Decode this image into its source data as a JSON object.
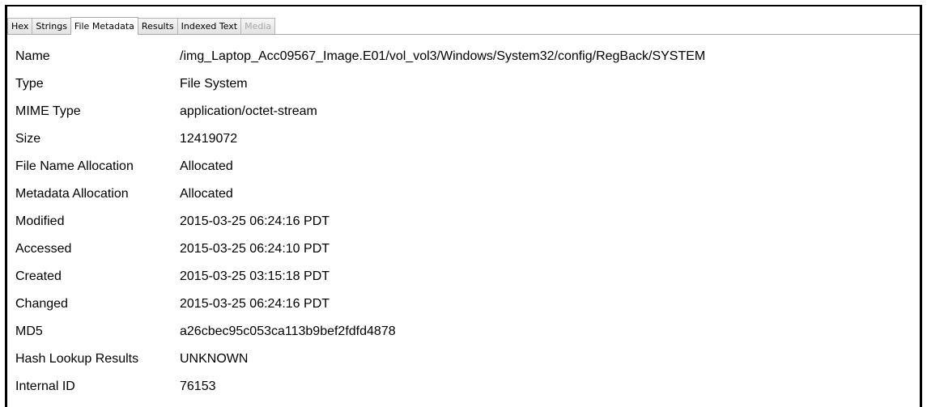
{
  "tabs": [
    {
      "label": "Hex",
      "selected": false,
      "enabled": true
    },
    {
      "label": "Strings",
      "selected": false,
      "enabled": true
    },
    {
      "label": "File Metadata",
      "selected": true,
      "enabled": true
    },
    {
      "label": "Results",
      "selected": false,
      "enabled": true
    },
    {
      "label": "Indexed Text",
      "selected": false,
      "enabled": true
    },
    {
      "label": "Media",
      "selected": false,
      "enabled": false
    }
  ],
  "metadata": {
    "rows": [
      {
        "key": "Name",
        "value": "/img_Laptop_Acc09567_Image.E01/vol_vol3/Windows/System32/config/RegBack/SYSTEM"
      },
      {
        "key": "Type",
        "value": "File System"
      },
      {
        "key": "MIME Type",
        "value": "application/octet-stream"
      },
      {
        "key": "Size",
        "value": "12419072"
      },
      {
        "key": "File Name Allocation",
        "value": "Allocated"
      },
      {
        "key": "Metadata Allocation",
        "value": "Allocated"
      },
      {
        "key": "Modified",
        "value": "2015-03-25 06:24:16 PDT"
      },
      {
        "key": "Accessed",
        "value": "2015-03-25 06:24:10 PDT"
      },
      {
        "key": "Created",
        "value": "2015-03-25 03:15:18 PDT"
      },
      {
        "key": "Changed",
        "value": "2015-03-25 06:24:16 PDT"
      },
      {
        "key": "MD5",
        "value": "a26cbec95c053ca113b9bef2fdfd4878"
      },
      {
        "key": "Hash Lookup Results",
        "value": "UNKNOWN"
      },
      {
        "key": "Internal ID",
        "value": "76153"
      }
    ]
  }
}
